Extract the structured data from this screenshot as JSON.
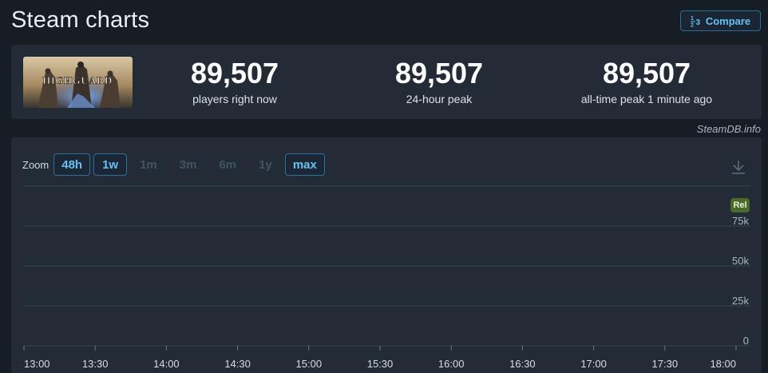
{
  "header": {
    "title": "Steam charts",
    "compare_label": "Compare"
  },
  "game": {
    "capsule_text": "HIGHGUARD"
  },
  "stats": [
    {
      "value": "89,507",
      "label": "players right now"
    },
    {
      "value": "89,507",
      "label": "24-hour peak"
    },
    {
      "value": "89,507",
      "label": "all-time peak 1 minute ago"
    }
  ],
  "credit": "SteamDB.info",
  "zoom": {
    "label": "Zoom",
    "options": [
      {
        "label": "48h",
        "active": true
      },
      {
        "label": "1w",
        "active": true
      },
      {
        "label": "1m",
        "active": false
      },
      {
        "label": "3m",
        "active": false
      },
      {
        "label": "6m",
        "active": false
      },
      {
        "label": "1y",
        "active": false
      },
      {
        "label": "max",
        "active": true
      }
    ]
  },
  "chart_data": {
    "type": "line",
    "title": "",
    "xlabel": "",
    "ylabel": "",
    "x_ticks": [
      "13:00",
      "13:30",
      "14:00",
      "14:30",
      "15:00",
      "15:30",
      "16:00",
      "16:30",
      "17:00",
      "17:30",
      "18:00"
    ],
    "y_ticks": [
      "0",
      "25k",
      "50k",
      "75k"
    ],
    "ylim": [
      0,
      100000
    ],
    "grid": true,
    "annotations": [
      {
        "label": "Rel"
      }
    ],
    "series": []
  },
  "colors": {
    "accent": "#66c0f4",
    "background": "#171d25",
    "panel": "#222b36",
    "rel_badge": "#4a6a2c"
  },
  "icons": {
    "compare": "compare-icon",
    "download": "download-icon"
  }
}
